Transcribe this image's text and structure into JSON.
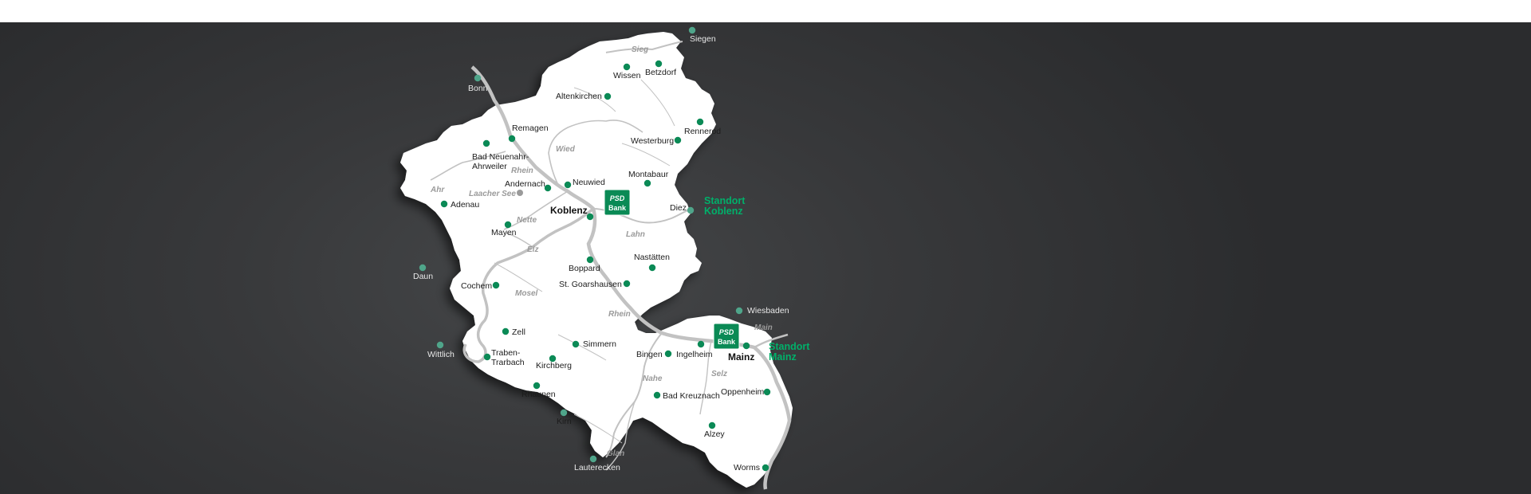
{
  "colors": {
    "dot": "#0b8a56",
    "dot_outside": "#4fa58a",
    "standort": "#00b06a",
    "region": "#ffffff",
    "river": "#c4c4c4",
    "slate": "#38393b",
    "logo_bg": "#0a8a55"
  },
  "cities": [
    {
      "id": "siegen",
      "name": "Siegen"
    },
    {
      "id": "wissen",
      "name": "Wissen"
    },
    {
      "id": "betzdorf",
      "name": "Betzdorf"
    },
    {
      "id": "bonn",
      "name": "Bonn"
    },
    {
      "id": "altenkirchen",
      "name": "Altenkirchen"
    },
    {
      "id": "remagen",
      "name": "Remagen"
    },
    {
      "id": "rennerod",
      "name": "Rennerod"
    },
    {
      "id": "westerburg",
      "name": "Westerburg"
    },
    {
      "id": "badneuenahr",
      "name": "Bad Neuenahr-\nAhrweiler"
    },
    {
      "id": "andernach",
      "name": "Andernach"
    },
    {
      "id": "neuwied",
      "name": "Neuwied"
    },
    {
      "id": "montabaur",
      "name": "Montabaur"
    },
    {
      "id": "adenau",
      "name": "Adenau"
    },
    {
      "id": "koblenz",
      "name": "Koblenz"
    },
    {
      "id": "diez",
      "name": "Diez"
    },
    {
      "id": "mayen",
      "name": "Mayen"
    },
    {
      "id": "boppard",
      "name": "Boppard"
    },
    {
      "id": "nastaetten",
      "name": "Nastätten"
    },
    {
      "id": "daun",
      "name": "Daun"
    },
    {
      "id": "cochem",
      "name": "Cochem"
    },
    {
      "id": "stgoarshausen",
      "name": "St. Goarshausen"
    },
    {
      "id": "wiesbaden",
      "name": "Wiesbaden"
    },
    {
      "id": "zell",
      "name": "Zell"
    },
    {
      "id": "simmern",
      "name": "Simmern"
    },
    {
      "id": "bingen",
      "name": "Bingen"
    },
    {
      "id": "ingelheim",
      "name": "Ingelheim"
    },
    {
      "id": "mainz",
      "name": "Mainz"
    },
    {
      "id": "wittlich",
      "name": "Wittlich"
    },
    {
      "id": "trabentrarbach",
      "name": "Traben-\nTrarbach"
    },
    {
      "id": "kirchberg",
      "name": "Kirchberg"
    },
    {
      "id": "oppenheim",
      "name": "Oppenheim"
    },
    {
      "id": "rhaunen",
      "name": "Rhaunen"
    },
    {
      "id": "badkreuznach",
      "name": "Bad Kreuznach"
    },
    {
      "id": "kirn",
      "name": "Kirn"
    },
    {
      "id": "alzey",
      "name": "Alzey"
    },
    {
      "id": "lauterecken",
      "name": "Lauterecken"
    },
    {
      "id": "worms",
      "name": "Worms"
    }
  ],
  "rivers": [
    "Sieg",
    "Wied",
    "Rhein",
    "Ahr",
    "Laacher See",
    "Nette",
    "Lahn",
    "Elz",
    "Mosel",
    "Rhein",
    "Main",
    "Nahe",
    "Selz",
    "Glan"
  ],
  "standorte": [
    {
      "line1": "Standort",
      "line2": "Koblenz"
    },
    {
      "line1": "Standort",
      "line2": "Mainz"
    }
  ],
  "logo": {
    "line1": "PSD",
    "line2": "Bank"
  }
}
